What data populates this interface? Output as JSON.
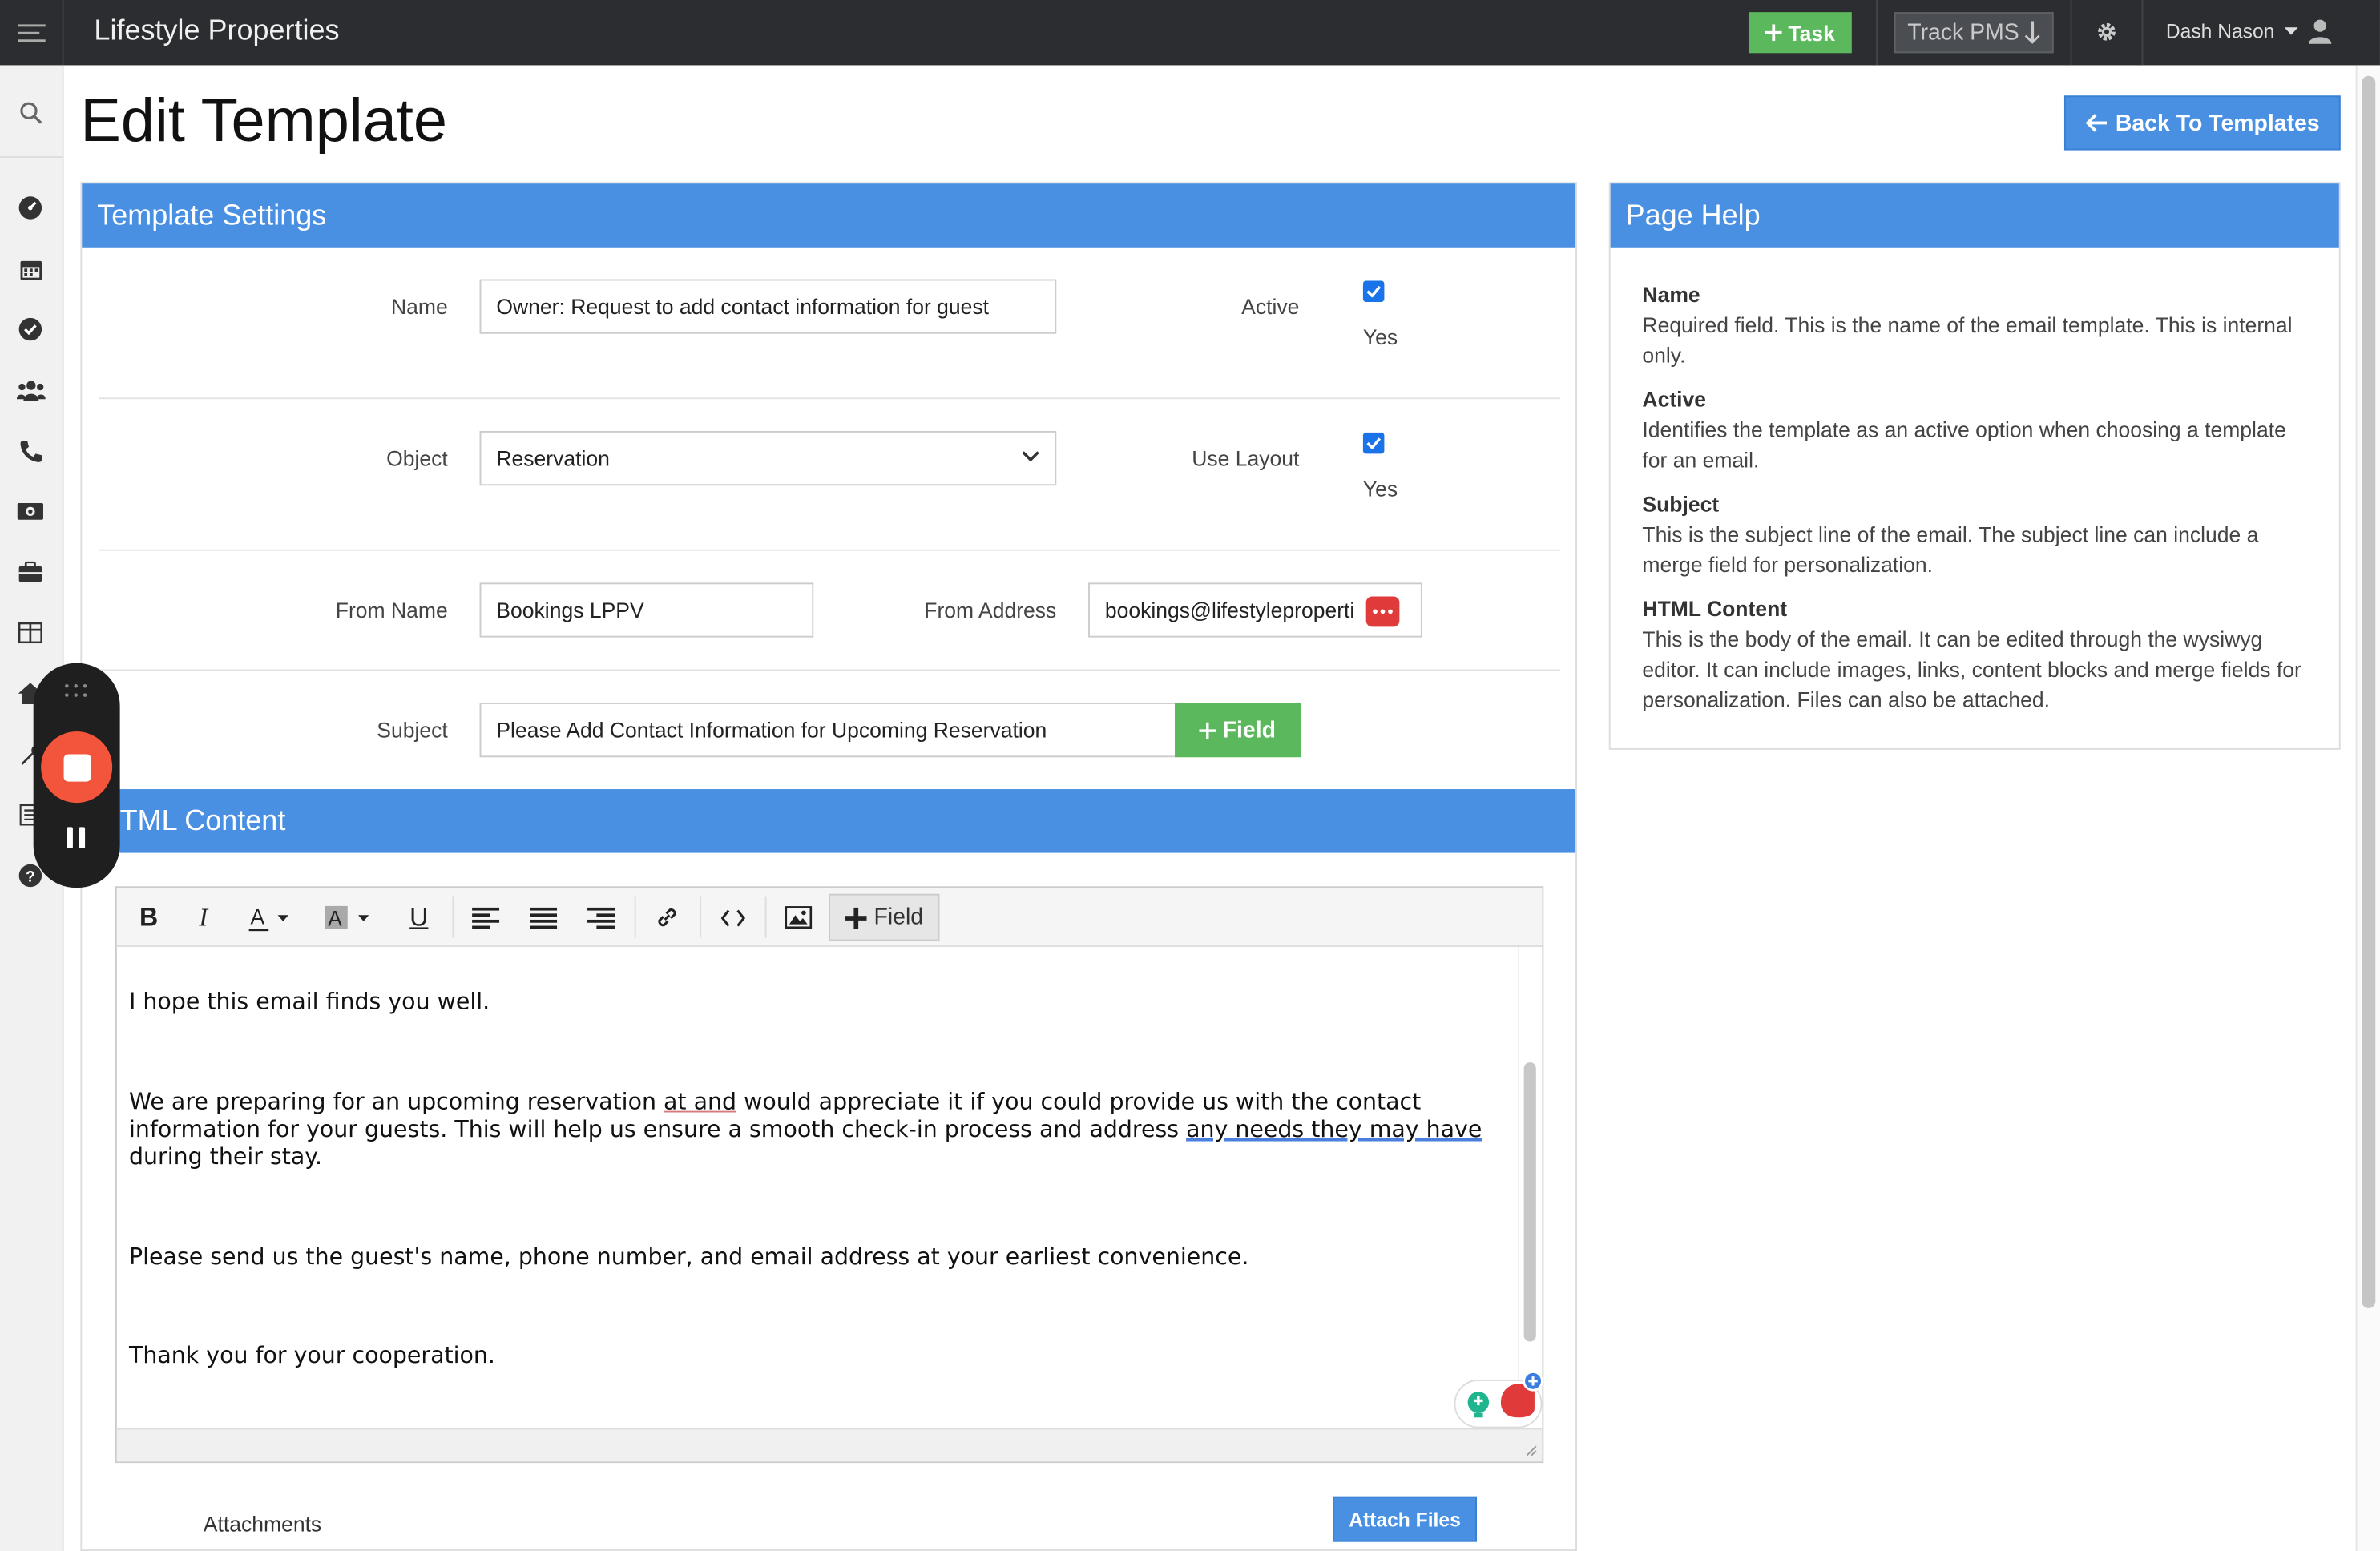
{
  "app": {
    "brand": "Lifestyle Properties",
    "task_button": "Task",
    "track_button": "Track PMS",
    "user_name": "Dash Nason"
  },
  "page": {
    "title": "Edit Template",
    "back_button": "Back To Templates"
  },
  "settings": {
    "header": "Template Settings",
    "name_label": "Name",
    "name_value": "Owner: Request to add contact information for guest",
    "active_label": "Active",
    "active_checked": true,
    "active_yes": "Yes",
    "object_label": "Object",
    "object_value": "Reservation",
    "use_layout_label": "Use Layout",
    "use_layout_checked": true,
    "use_layout_yes": "Yes",
    "from_name_label": "From Name",
    "from_name_value": "Bookings LPPV",
    "from_address_label": "From Address",
    "from_address_value": "bookings@lifestyleproperti",
    "subject_label": "Subject",
    "subject_value": "Please Add Contact Information for Upcoming Reservation",
    "field_button": "Field"
  },
  "help": {
    "header": "Page Help",
    "items": [
      {
        "term": "Name",
        "desc": "Required field. This is the name of the email template. This is internal only."
      },
      {
        "term": "Active",
        "desc": "Identifies the template as an active option when choosing a template for an email."
      },
      {
        "term": "Subject",
        "desc": "This is the subject line of the email. The subject line can include a merge field for personalization."
      },
      {
        "term": "HTML Content",
        "desc": "This is the body of the email. It can be edited through the wysiwyg editor. It can include images, links, content blocks and merge fields for personalization. Files can also be attached."
      }
    ]
  },
  "html_content": {
    "header": "TML Content",
    "toolbar_field_button": "Field",
    "body": {
      "p1": "I hope this email finds you well.",
      "p2_a": "We are preparing for an upcoming reservation ",
      "p2_at": "at  and",
      "p2_b": " would appreciate it if you could provide us with the contact information for your guests. This will help us ensure a smooth check-in process and address ",
      "p2_needs": "any needs they may have",
      "p2_c": " during their stay.",
      "p3": "Please send us the guest's name, phone number, and email address at your earliest convenience.",
      "p4": "Thank you for your cooperation."
    },
    "attachments_label": "Attachments",
    "attach_button": "Attach Files"
  },
  "colors": {
    "topbar": "#2b2d30",
    "panel_header": "#4a90e2",
    "green": "#5cb85c",
    "recorder_stop": "#f2553b"
  },
  "icons": {
    "menu": "hamburger-icon",
    "search": "search-icon",
    "dashboard": "dashboard-icon",
    "calendar": "calendar-icon",
    "tasks": "check-circle-icon",
    "contacts": "users-icon",
    "phone": "phone-icon",
    "money": "money-icon",
    "briefcase": "briefcase-icon",
    "grid": "grid-icon",
    "help": "help-icon"
  }
}
